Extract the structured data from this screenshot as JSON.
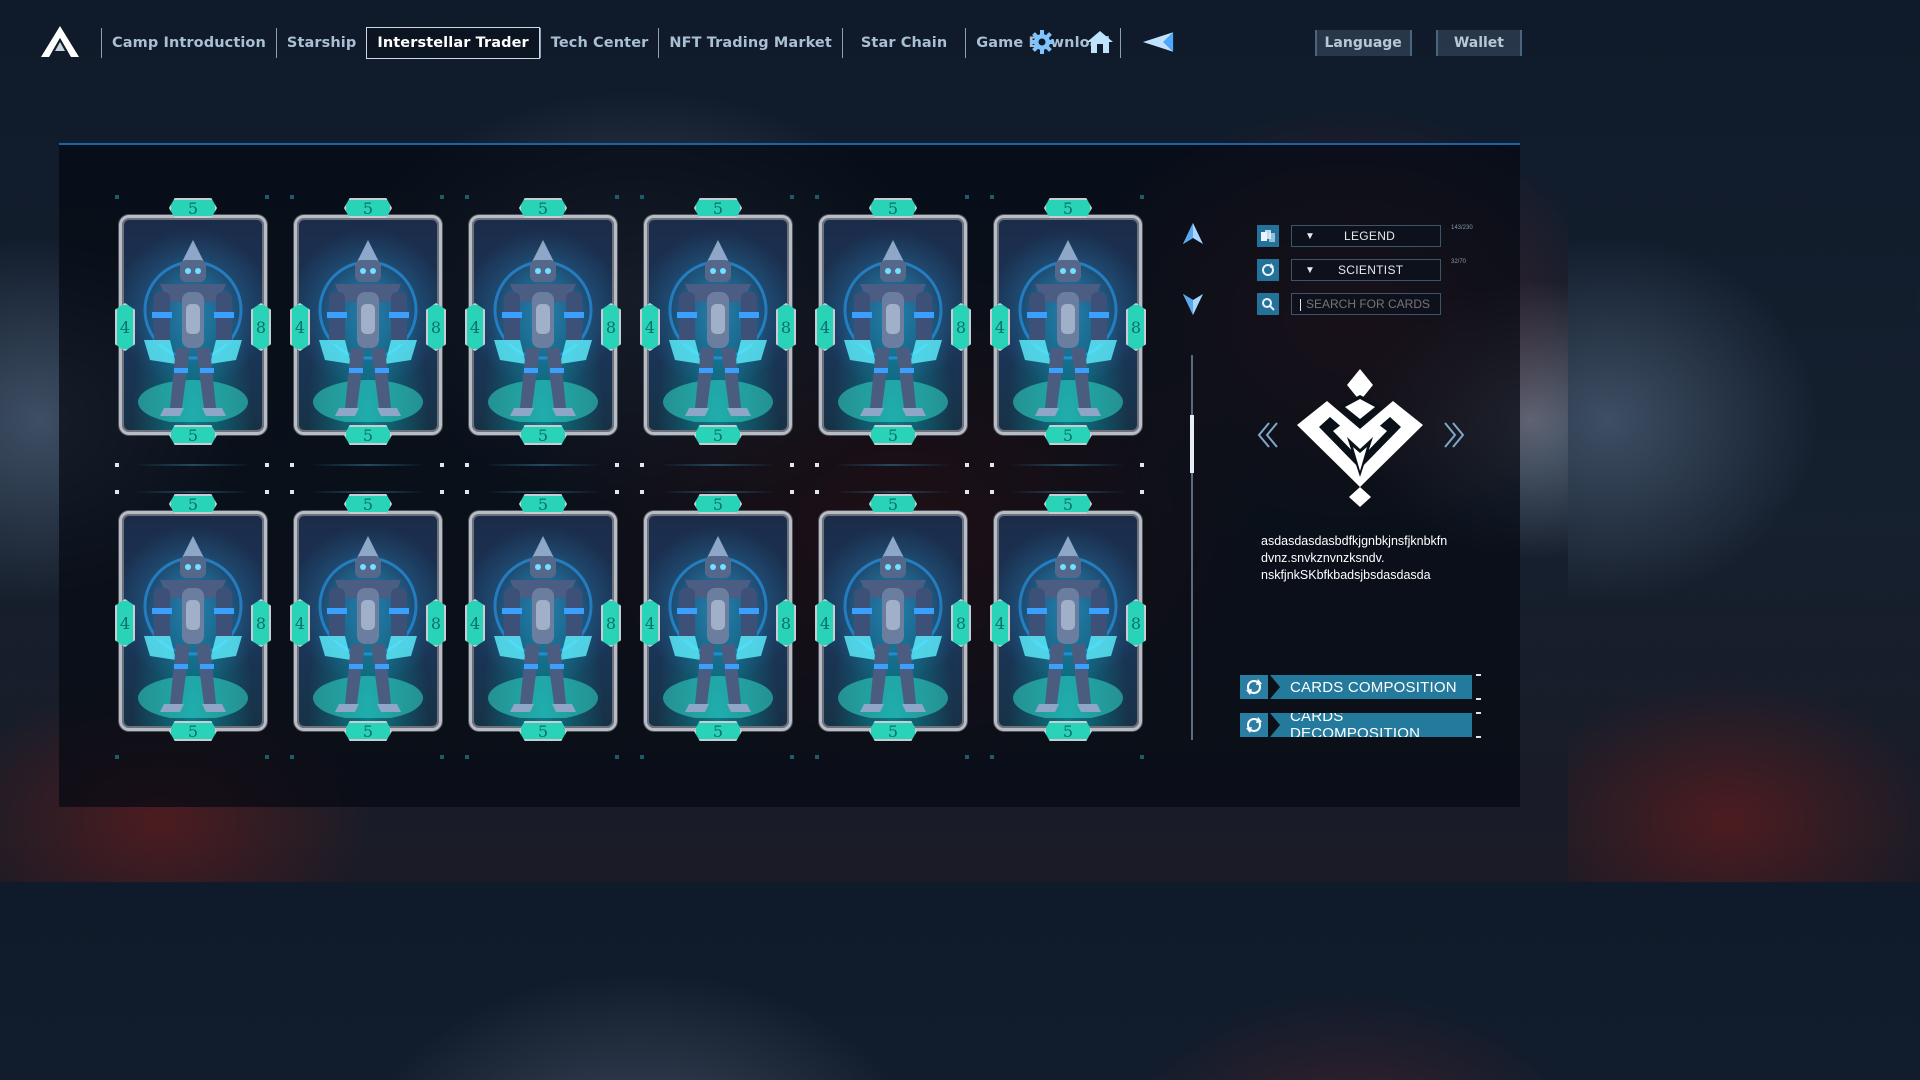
{
  "nav": {
    "items": [
      {
        "label": "Camp Introduction",
        "active": false
      },
      {
        "label": "Starship",
        "active": false
      },
      {
        "label": "Interstellar Trader",
        "active": true
      },
      {
        "label": "Tech Center",
        "active": false
      },
      {
        "label": "NFT Trading Market",
        "active": false
      },
      {
        "label": "Star Chain",
        "active": false
      },
      {
        "label": "Game Download",
        "active": false
      }
    ],
    "icons": [
      "gear-icon",
      "home-icon",
      "send-icon"
    ],
    "language_label": "Language",
    "wallet_label": "Wallet"
  },
  "cards": {
    "rows": 2,
    "per_row": 6,
    "stats": {
      "top": "5",
      "left": "4",
      "right": "8",
      "bottom": "5"
    }
  },
  "filters": {
    "rarity": {
      "label": "LEGEND",
      "count": "143/230"
    },
    "profession": {
      "label": "SCIENTIST",
      "count": "32/70"
    },
    "search": {
      "placeholder": "SEARCH FOR CARDS",
      "value": ""
    }
  },
  "description": {
    "lines": [
      "asdasdasdasbdfkjgnbkjnsfjknbkfn",
      "dvnz.snvkznvnzksndv.",
      "nskfjnkSKbfkbadsjbsdasdasda"
    ]
  },
  "actions": {
    "compose_label": "CARDS COMPOSITION",
    "decompose_label": "CARDS DECOMPOSITION"
  },
  "colors": {
    "accent": "#247a9c",
    "gem": "#29d3b8",
    "panel_border": "#1c62a8"
  }
}
